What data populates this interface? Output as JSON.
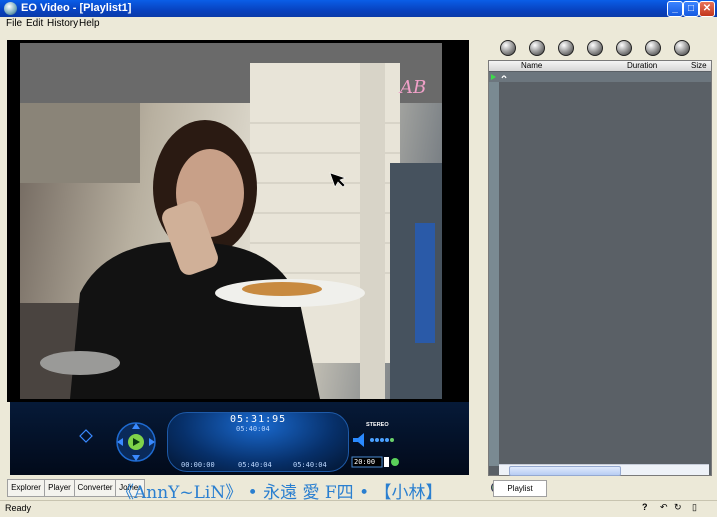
{
  "window": {
    "title": "EO Video - [Playlist1]"
  },
  "menu": [
    "File",
    "Edit",
    "History",
    "Help"
  ],
  "player": {
    "current_time": "05:31:95",
    "total_time": "05:40:04",
    "left_time": "00:00:00",
    "mid_time": "05:40:04",
    "right_time": "05:40:04",
    "stereo_label": "STEREO",
    "volume_readout": "20:00",
    "logo_text": "AB"
  },
  "tabs": [
    "Explorer",
    "Player",
    "Converter",
    "Joiner"
  ],
  "marquee_text": "《AnnY~LiN》 • 永遠 愛 F四  • 【小林】",
  "playlist": {
    "tab_label": "Playlist",
    "columns": [
      "Name",
      "Duration",
      "Size"
    ],
    "rows": [
      {
        "name": "",
        "duration": "",
        "size": ""
      }
    ]
  },
  "status": {
    "text": "Ready",
    "help_label": "?"
  },
  "colors": {
    "titlebar": "#0a5ee8",
    "list_bg": "#5a6066",
    "row_text": "#3cd94a",
    "marquee": "#2a7fd0"
  }
}
